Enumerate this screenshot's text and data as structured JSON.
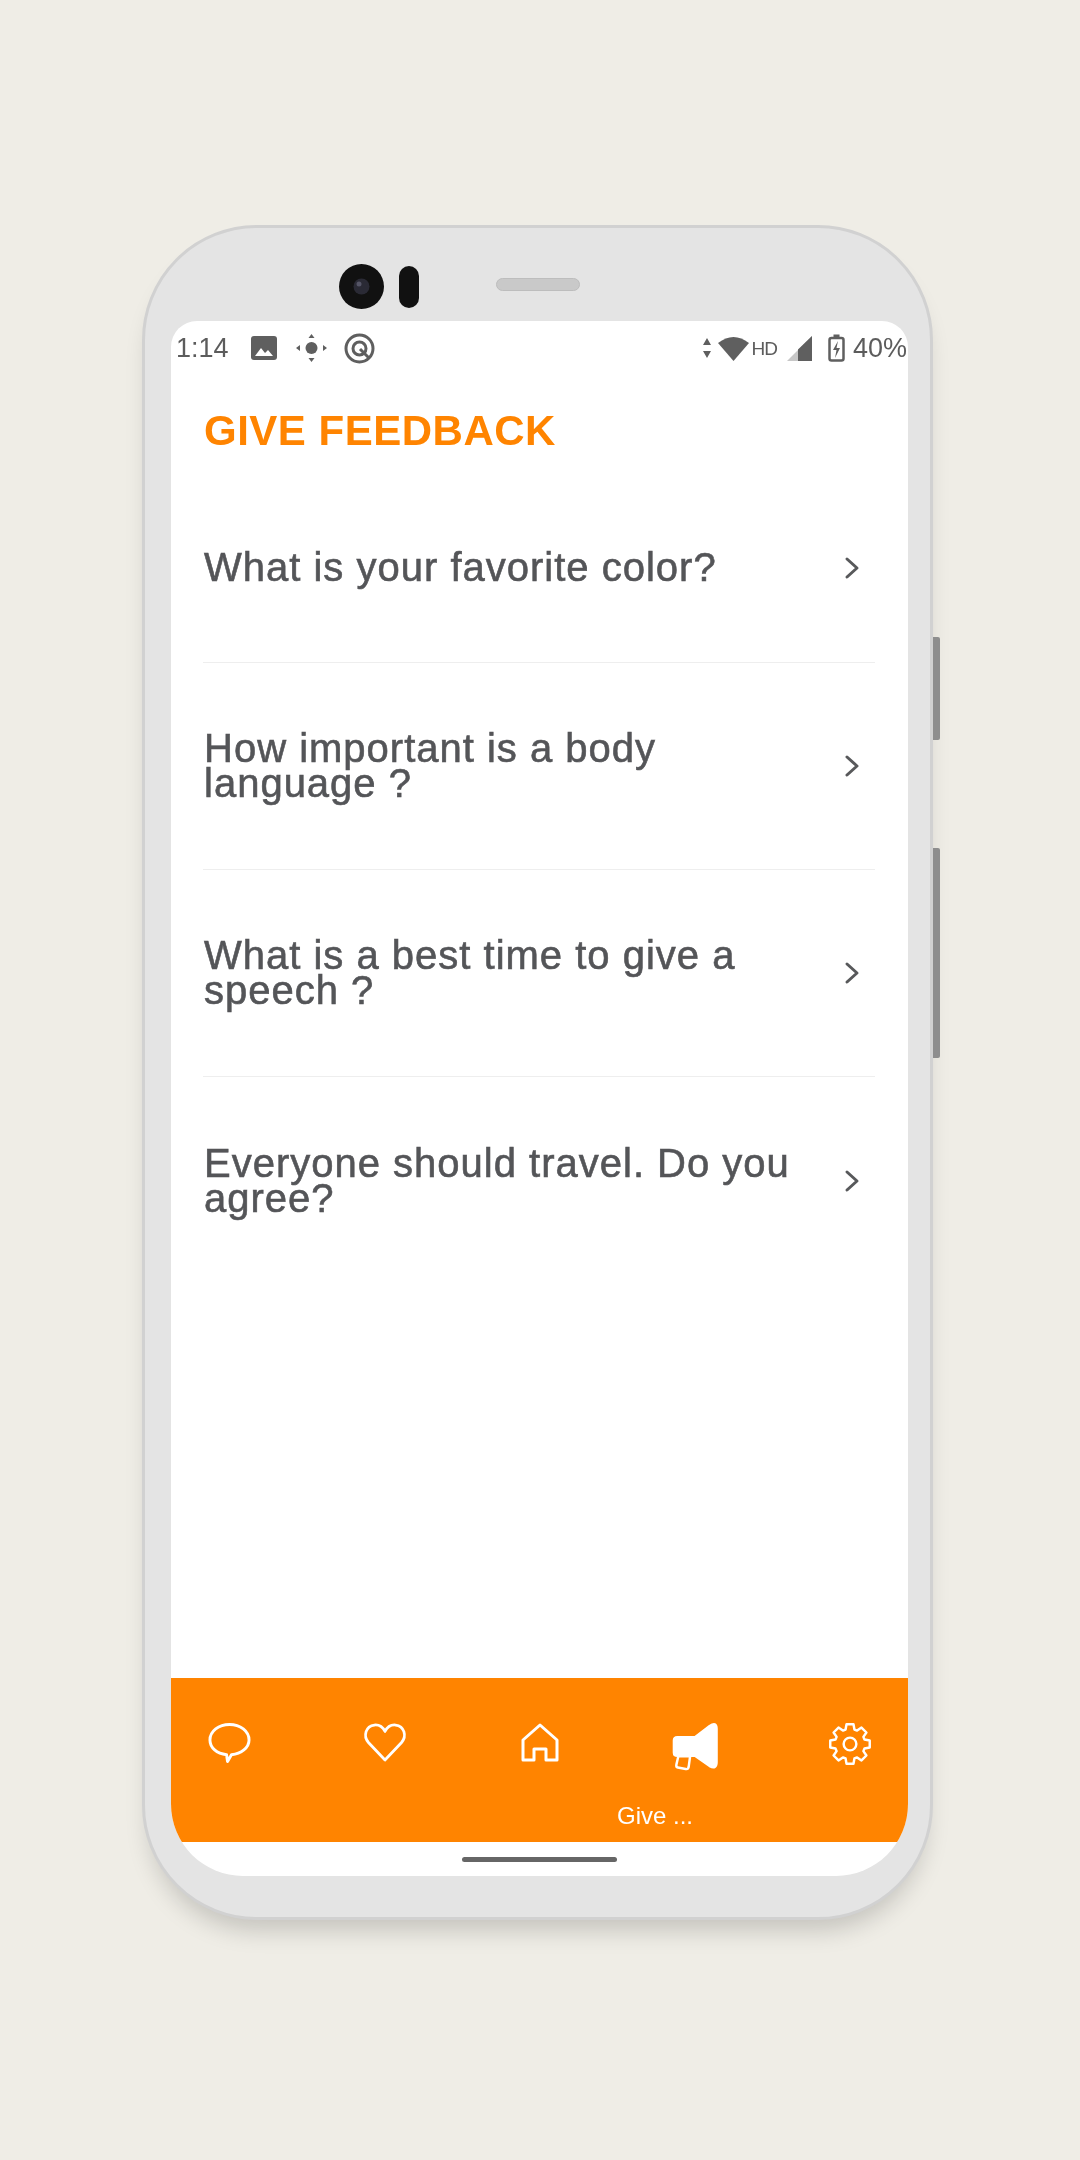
{
  "status_bar": {
    "time": "1:14",
    "network": "HD",
    "battery": "40%"
  },
  "header": {
    "title": "GIVE FEEDBACK"
  },
  "questions": [
    {
      "text": "What is your favorite color?"
    },
    {
      "text": "How important is a body language ?"
    },
    {
      "text": "What is a best time to give a speech ?"
    },
    {
      "text": "Everyone should travel. Do you agree?"
    }
  ],
  "bottom_nav": [
    {
      "selected": false
    },
    {
      "selected": false
    },
    {
      "selected": false
    },
    {
      "selected": true,
      "label": "Give ..."
    },
    {
      "selected": false
    }
  ]
}
